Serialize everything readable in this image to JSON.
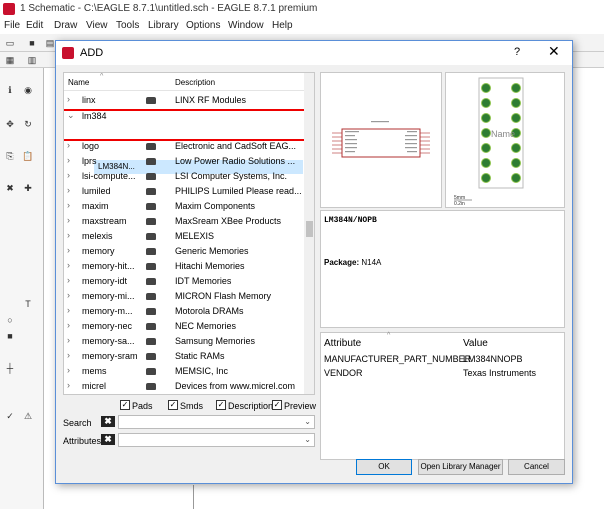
{
  "app": {
    "title": "1 Schematic - C:\\EAGLE 8.7.1\\untitled.sch - EAGLE 8.7.1 premium",
    "menu": [
      "File",
      "Edit",
      "Draw",
      "View",
      "Tools",
      "Library",
      "Options",
      "Window",
      "Help"
    ]
  },
  "dialog": {
    "title": "ADD",
    "help": "?",
    "close": "✕",
    "columns": {
      "name": "Name",
      "description": "Description"
    },
    "rows": [
      {
        "name": "linx",
        "description": "LINX RF Modules"
      },
      {
        "name": "lm384",
        "description": ""
      },
      {
        "name": "logo",
        "description": "Electronic and CadSoft EAG..."
      },
      {
        "name": "lprs",
        "description": "Low Power Radio Solutions ..."
      },
      {
        "name": "lsi-compute...",
        "description": "LSI Computer Systems, Inc."
      },
      {
        "name": "lumiled",
        "description": "PHILIPS Lumiled Please read..."
      },
      {
        "name": "maxim",
        "description": "Maxim Components"
      },
      {
        "name": "maxstream",
        "description": "MaxSream XBee Products"
      },
      {
        "name": "melexis",
        "description": "MELEXIS"
      },
      {
        "name": "memory",
        "description": "Generic Memories"
      },
      {
        "name": "memory-hit...",
        "description": "Hitachi Memories"
      },
      {
        "name": "memory-idt",
        "description": "IDT Memories"
      },
      {
        "name": "memory-mi...",
        "description": "MICRON Flash Memory"
      },
      {
        "name": "memory-m...",
        "description": "Motorola DRAMs"
      },
      {
        "name": "memory-nec",
        "description": "NEC Memories"
      },
      {
        "name": "memory-sa...",
        "description": "Samsung Memories"
      },
      {
        "name": "memory-sram",
        "description": "Static RAMs"
      },
      {
        "name": "mems",
        "description": "MEMSIC, Inc"
      },
      {
        "name": "micrel",
        "description": "Devices from www.micrel.com"
      }
    ],
    "selected_child": "LM384N...",
    "checks": {
      "pads": "Pads",
      "smds": "Smds",
      "description": "Description",
      "preview": "Preview"
    },
    "search_label": "Search",
    "attributes_label": "Attributes",
    "part_name": "LM384N/NOPB",
    "package_label": "Package:",
    "package_value": "N14A",
    "package_name": "Name",
    "scale_text": "5mm",
    "scale_sub": "0.2in",
    "attr_headers": {
      "attribute": "Attribute",
      "value": "Value"
    },
    "attributes": [
      {
        "key": "MANUFACTURER_PART_NUMBER",
        "value": "LM384NNOPB"
      },
      {
        "key": "VENDOR",
        "value": "Texas Instruments"
      }
    ],
    "buttons": {
      "ok": "OK",
      "open_library_manager": "Open Library Manager",
      "cancel": "Cancel"
    }
  },
  "colors": {
    "selection": "#cce8ff",
    "highlight": "#e00000",
    "package_pin": "#2e7d32",
    "accent": "#0078d7"
  }
}
